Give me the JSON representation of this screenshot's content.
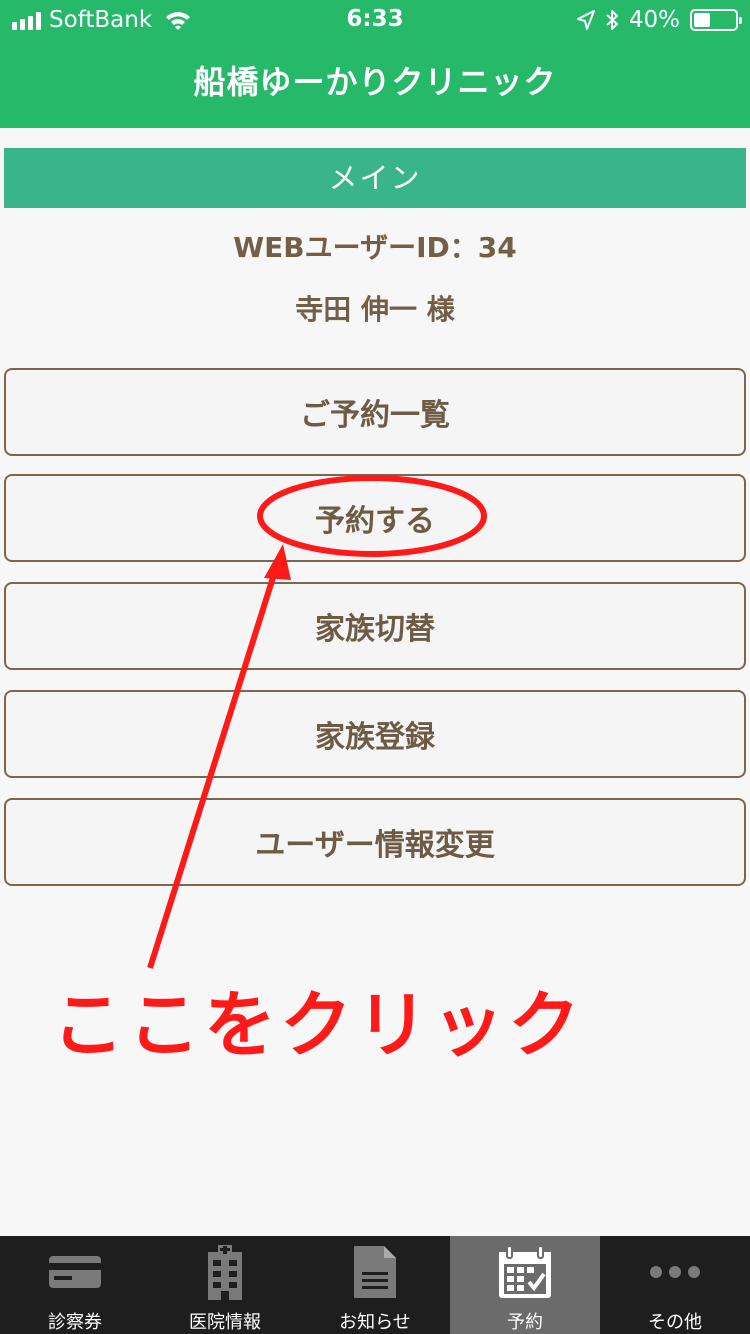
{
  "status_bar": {
    "carrier": "SoftBank",
    "time": "6:33",
    "battery_percent_text": "40%",
    "battery_level": 0.4
  },
  "header": {
    "title": "船橋ゆーかりクリニック"
  },
  "section": {
    "title": "メイン"
  },
  "user": {
    "id_line": "WEBユーザーID：34",
    "name_line": "寺田 伸一 様"
  },
  "menu": [
    {
      "label": "ご予約一覧"
    },
    {
      "label": "予約する"
    },
    {
      "label": "家族切替"
    },
    {
      "label": "家族登録"
    },
    {
      "label": "ユーザー情報変更"
    }
  ],
  "annotation": {
    "text": "ここをクリック",
    "color": "#ff1a1a"
  },
  "tabbar": {
    "active_index": 3,
    "tabs": [
      {
        "label": "診察券",
        "icon": "card-icon"
      },
      {
        "label": "医院情報",
        "icon": "building-icon"
      },
      {
        "label": "お知らせ",
        "icon": "document-icon"
      },
      {
        "label": "予約",
        "icon": "calendar-icon"
      },
      {
        "label": "その他",
        "icon": "more-icon"
      }
    ]
  },
  "colors": {
    "brand_green": "#27b96a",
    "section_green": "#3ab58b",
    "text_brown": "#6e5b45",
    "tabbar_bg": "#1e1e1e",
    "tab_active_bg": "#6b6b6b"
  }
}
